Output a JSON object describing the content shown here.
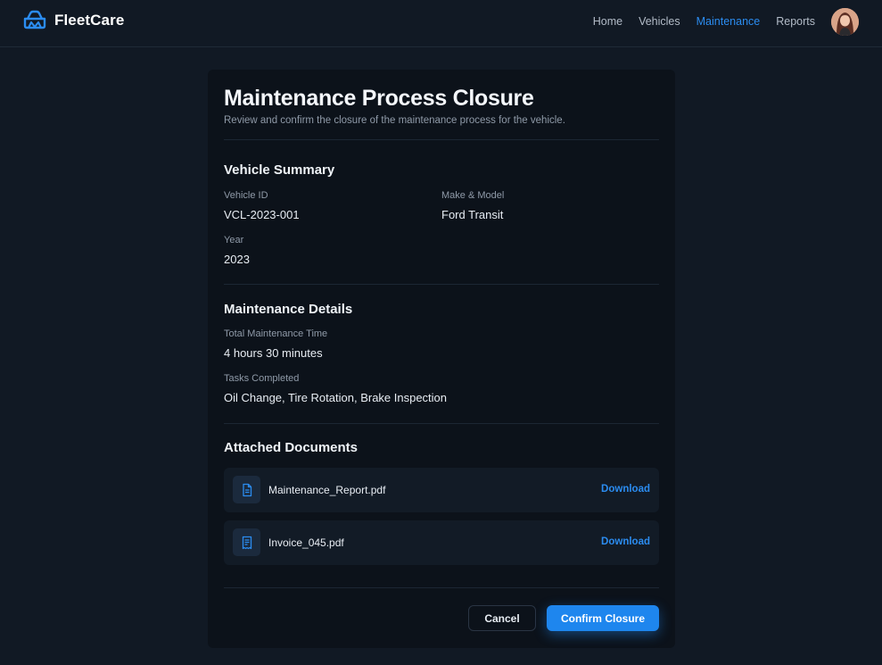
{
  "header": {
    "brand": "FleetCare",
    "nav": [
      {
        "label": "Home",
        "active": false
      },
      {
        "label": "Vehicles",
        "active": false
      },
      {
        "label": "Maintenance",
        "active": true
      },
      {
        "label": "Reports",
        "active": false
      }
    ],
    "accent_color": "#2b8cf0"
  },
  "page": {
    "title": "Maintenance Process Closure",
    "subtitle": "Review and confirm the closure of the maintenance process for the vehicle."
  },
  "vehicle_summary": {
    "heading": "Vehicle Summary",
    "fields": [
      {
        "label": "Vehicle ID",
        "value": "VCL-2023-001"
      },
      {
        "label": "Make & Model",
        "value": "Ford Transit"
      },
      {
        "label": "Year",
        "value": "2023"
      }
    ]
  },
  "maintenance_details": {
    "heading": "Maintenance Details",
    "fields": [
      {
        "label": "Total Maintenance Time",
        "value": "4 hours 30 minutes"
      },
      {
        "label": "Tasks Completed",
        "value": "Oil Change, Tire Rotation, Brake Inspection"
      }
    ]
  },
  "attached_documents": {
    "heading": "Attached Documents",
    "items": [
      {
        "name": "Maintenance_Report.pdf",
        "icon": "document-icon",
        "action": "Download"
      },
      {
        "name": "Invoice_045.pdf",
        "icon": "receipt-icon",
        "action": "Download"
      }
    ]
  },
  "actions": {
    "cancel": "Cancel",
    "confirm": "Confirm Closure"
  }
}
